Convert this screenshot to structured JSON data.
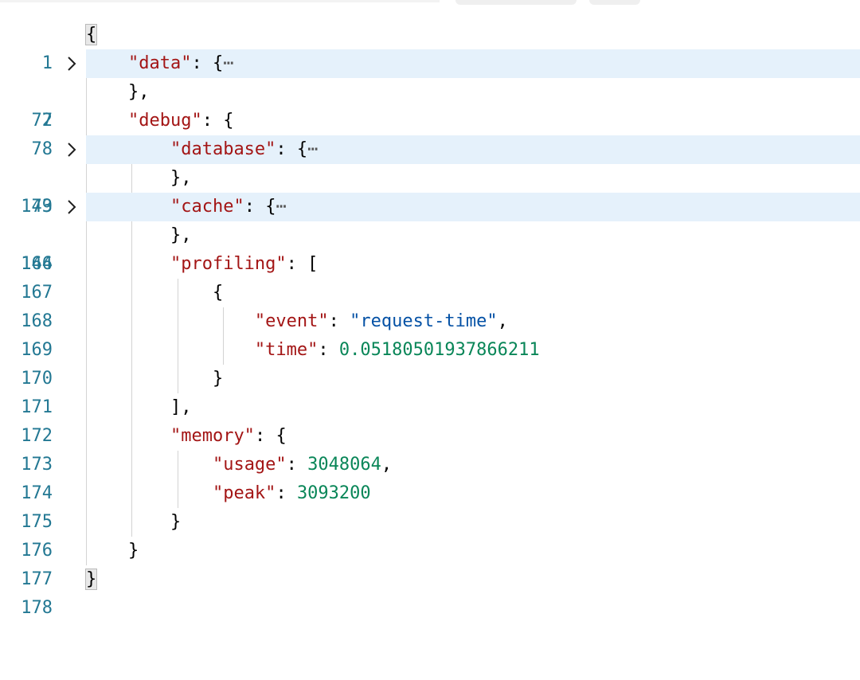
{
  "lines": [
    {
      "num": "1"
    },
    {
      "num": "2"
    },
    {
      "num": "77"
    },
    {
      "num": "78"
    },
    {
      "num": "79"
    },
    {
      "num": "143"
    },
    {
      "num": "144"
    },
    {
      "num": "166"
    },
    {
      "num": "167"
    },
    {
      "num": "168"
    },
    {
      "num": "169"
    },
    {
      "num": "170"
    },
    {
      "num": "171"
    },
    {
      "num": "172"
    },
    {
      "num": "173"
    },
    {
      "num": "174"
    },
    {
      "num": "175"
    },
    {
      "num": "176"
    },
    {
      "num": "177"
    },
    {
      "num": "178"
    }
  ],
  "code": {
    "brace_open": "{",
    "brace_close": "}",
    "brace_close_comma": "},",
    "bracket_open": "[",
    "bracket_close_comma": "],",
    "colon": ": ",
    "comma": ",",
    "ellipsis": "⋯",
    "key_data": "\"data\"",
    "key_debug": "\"debug\"",
    "key_database": "\"database\"",
    "key_cache": "\"cache\"",
    "key_profiling": "\"profiling\"",
    "key_event": "\"event\"",
    "val_event": "\"request-time\"",
    "key_time": "\"time\"",
    "val_time": "0.05180501937866211",
    "key_memory": "\"memory\"",
    "key_usage": "\"usage\"",
    "val_usage": "3048064",
    "key_peak": "\"peak\"",
    "val_peak": "3093200"
  },
  "colors": {
    "key": "#a31515",
    "string": "#0451a5",
    "number": "#098658",
    "line_number": "#237893",
    "folded_line_highlight": "#e5f1fb"
  },
  "icons": {
    "fold": "chevron-right-icon"
  }
}
